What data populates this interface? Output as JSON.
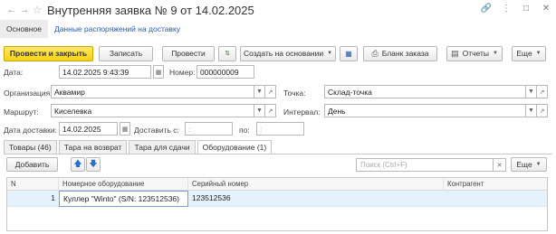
{
  "window": {
    "title": "Внутренняя заявка № 9 от 14.02.2025"
  },
  "top_tabs": {
    "main": "Основное",
    "distribution": "Данные распоряжений на доставку"
  },
  "toolbar": {
    "post_close": "Провести и закрыть",
    "save": "Записать",
    "post": "Провести",
    "create_based": "Создать на основании",
    "order_form": "Бланк заказа",
    "reports": "Отчеты",
    "more": "Еще"
  },
  "form": {
    "date_label": "Дата:",
    "date_value": "14.02.2025  9:43:39",
    "number_label": "Номер:",
    "number_value": "000000009",
    "org_label": "Организация:",
    "org_value": "Аквамир",
    "point_label": "Точка:",
    "point_value": "Склад-точка",
    "route_label": "Маршрут:",
    "route_value": "Киселевка",
    "interval_label": "Интервал:",
    "interval_value": "День",
    "delivery_date_label": "Дата доставки:",
    "delivery_date_value": "14.02.2025",
    "deliver_from_label": "Доставить с:",
    "deliver_from_value": ":",
    "to_label": "по:",
    "to_value": ":"
  },
  "form_tabs": [
    "Товары (46)",
    "Тара на возврат",
    "Тара для сдачи",
    "Оборудование (1)"
  ],
  "table_toolbar": {
    "add": "Добавить",
    "search_placeholder": "Поиск (Ctrl+F)",
    "more": "Еще"
  },
  "table": {
    "columns": [
      "N",
      "Номерное оборудование",
      "Серийный номер",
      "Контрагент"
    ],
    "rows": [
      {
        "n": "1",
        "equipment": "Куллер \"Winto\" (S/N: 123512536)",
        "serial": "123512536",
        "counterparty": ""
      }
    ]
  },
  "colors": {
    "primary_button": "#f6d114",
    "link": "#2a5ca8",
    "selected_row": "#e5f1fb"
  }
}
